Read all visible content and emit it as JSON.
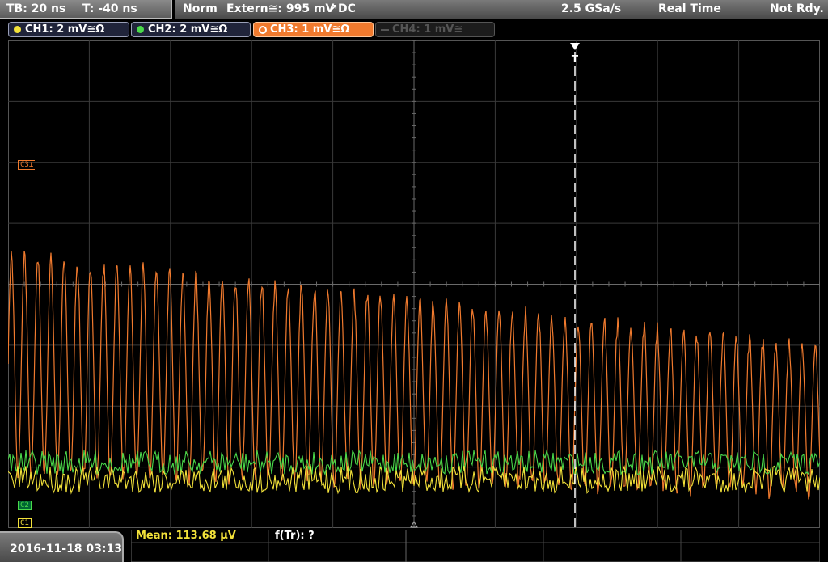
{
  "timebase": {
    "label": "TB: 20 ns",
    "trigger_time": "T: -40 ns"
  },
  "acquisition": {
    "mode": "Norm",
    "trigger_source": "Extern≅: 995 mV",
    "trigger_slope": "↗",
    "coupling": "DC",
    "sample_rate": "2.5 GSa/s",
    "acq_mode": "Real Time",
    "status": "Not Rdy."
  },
  "channels": [
    {
      "id": "ch1",
      "label": "CH1: 2 mV≅Ω",
      "color": "#f3e23a",
      "active": true
    },
    {
      "id": "ch2",
      "label": "CH2: 2 mV≅Ω",
      "color": "#4ad94a",
      "active": true
    },
    {
      "id": "ch3",
      "label": "CH3: 1 mV≅Ω",
      "color": "#f07a2e",
      "active": true,
      "selected": true
    },
    {
      "id": "ch4",
      "label": "CH4: 1 mV≅",
      "color": "#555555",
      "active": false
    }
  ],
  "markers": {
    "ch3": "C3⊥",
    "ch2": "C2",
    "ch1": "C1",
    "trigger": "T"
  },
  "measurements": {
    "mean_label": "Mean: 113.68 µV",
    "freq_label": "f(Tr): ?"
  },
  "datetime": "2016-11-18 03:13",
  "colors": {
    "ch1": "#f3e23a",
    "ch2": "#4ad94a",
    "ch3": "#f07a2e",
    "grid": "#3a3a3a",
    "grid_axis": "#6a6a6a"
  }
}
